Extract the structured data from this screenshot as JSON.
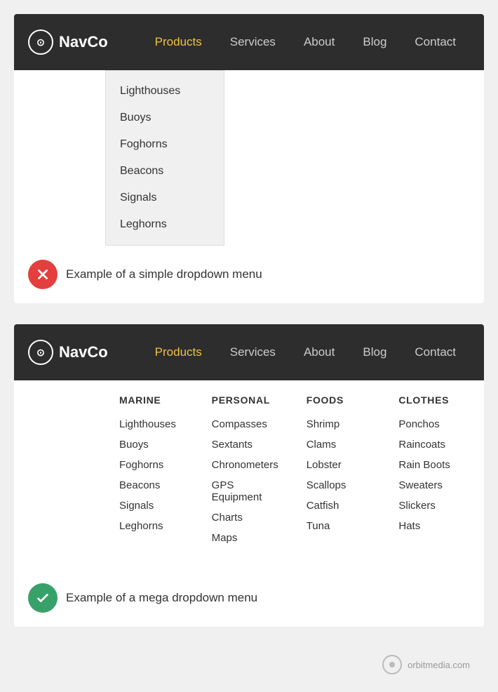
{
  "top_navbar": {
    "logo_symbol": "⊙",
    "logo_name": "NavCo",
    "nav_items": [
      {
        "label": "Products",
        "active": true
      },
      {
        "label": "Services",
        "active": false
      },
      {
        "label": "About",
        "active": false
      },
      {
        "label": "Blog",
        "active": false
      },
      {
        "label": "Contact",
        "active": false
      }
    ]
  },
  "simple_dropdown": {
    "items": [
      "Lighthouses",
      "Buoys",
      "Foghorns",
      "Beacons",
      "Signals",
      "Leghorns"
    ]
  },
  "example_simple": {
    "label": "Example of a simple dropdown menu"
  },
  "bottom_navbar": {
    "logo_symbol": "⊙",
    "logo_name": "NavCo",
    "nav_items": [
      {
        "label": "Products",
        "active": true
      },
      {
        "label": "Services",
        "active": false
      },
      {
        "label": "About",
        "active": false
      },
      {
        "label": "Blog",
        "active": false
      },
      {
        "label": "Contact",
        "active": false
      }
    ]
  },
  "mega_menu": {
    "columns": [
      {
        "header": "MARINE",
        "items": [
          "Lighthouses",
          "Buoys",
          "Foghorns",
          "Beacons",
          "Signals",
          "Leghorns"
        ]
      },
      {
        "header": "PERSONAL",
        "items": [
          "Compasses",
          "Sextants",
          "Chronometers",
          "GPS Equipment",
          "Charts",
          "Maps"
        ]
      },
      {
        "header": "FOODS",
        "items": [
          "Shrimp",
          "Clams",
          "Lobster",
          "Scallops",
          "Catfish",
          "Tuna"
        ]
      },
      {
        "header": "CLOTHES",
        "items": [
          "Ponchos",
          "Raincoats",
          "Rain Boots",
          "Sweaters",
          "Slickers",
          "Hats"
        ]
      }
    ]
  },
  "example_mega": {
    "label": "Example of a mega dropdown menu"
  },
  "watermark": {
    "text": "orbitmedia.com"
  }
}
